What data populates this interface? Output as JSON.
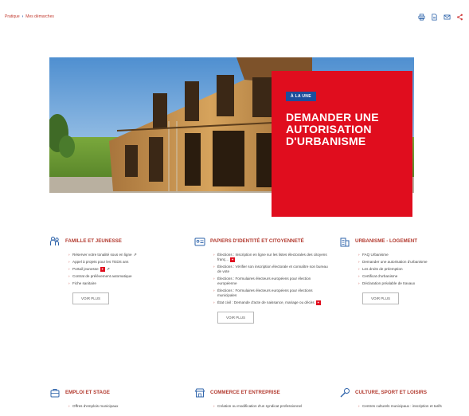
{
  "breadcrumb": {
    "home": "Pratique",
    "current": "Mes démarches"
  },
  "toolbar": {
    "icons": [
      "print-icon",
      "pdf-icon",
      "mail-icon",
      "share-icon"
    ]
  },
  "hero": {
    "tag": "À LA UNE",
    "title": "DEMANDER UNE AUTORISATION D'URBANISME"
  },
  "tiles": [
    {
      "icon": "family-icon",
      "title": "FAMILLE ET JEUNESSE",
      "items": [
        {
          "text": "Réserver votre tonalité sous en ligne",
          "mark": "ext"
        },
        {
          "text": "Appel à projets pour les TEDS ans",
          "mark": ""
        },
        {
          "text": "Portail jeunesse",
          "mark": "both"
        },
        {
          "text": "Contrat de prélèvement automatique",
          "mark": ""
        },
        {
          "text": "Fiche sanitaire",
          "mark": ""
        }
      ],
      "more": "VOIR PLUS"
    },
    {
      "icon": "id-card-icon",
      "title": "PAPIERS D'IDENTITÉ ET CITOYENNETÉ",
      "items": [
        {
          "text": "Élections : Inscription en ligne sur les listes électorales des citoyens franç...",
          "mark": "badge"
        },
        {
          "text": "Élections : Vérifier son inscription électorale et connaître son bureau de vote",
          "mark": ""
        },
        {
          "text": "Élections : Formulaires électeurs européens pour élection européenne",
          "mark": ""
        },
        {
          "text": "Élections : Formulaires électeurs européens pour élections municipales",
          "mark": ""
        },
        {
          "text": "État civil : Demande d'acte de naissance, mariage ou décès",
          "mark": "badge"
        }
      ],
      "more": "VOIR PLUS"
    },
    {
      "icon": "building-icon",
      "title": "URBANISME - LOGEMENT",
      "items": [
        {
          "text": "FAQ Urbanisme",
          "mark": ""
        },
        {
          "text": "Demander une autorisation d'urbanisme",
          "mark": ""
        },
        {
          "text": "Les droits de préemption",
          "mark": ""
        },
        {
          "text": "Certificat d'urbanisme",
          "mark": ""
        },
        {
          "text": "Déclaration préalable de travaux",
          "mark": ""
        }
      ],
      "more": "VOIR PLUS"
    },
    {
      "icon": "briefcase-icon",
      "title": "EMPLOI ET STAGE",
      "items": [
        {
          "text": "Offres d'emplois municipaux",
          "mark": ""
        }
      ],
      "more": ""
    },
    {
      "icon": "shop-icon",
      "title": "COMMERCE ET ENTREPRISE",
      "items": [
        {
          "text": "Création ou modification d'un syndicat professionnel",
          "mark": ""
        }
      ],
      "more": ""
    },
    {
      "icon": "sport-icon",
      "title": "CULTURE, SPORT ET LOISIRS",
      "items": [
        {
          "text": "Centres culturels municipaux : inscription et tarifs",
          "mark": ""
        }
      ],
      "more": ""
    }
  ]
}
